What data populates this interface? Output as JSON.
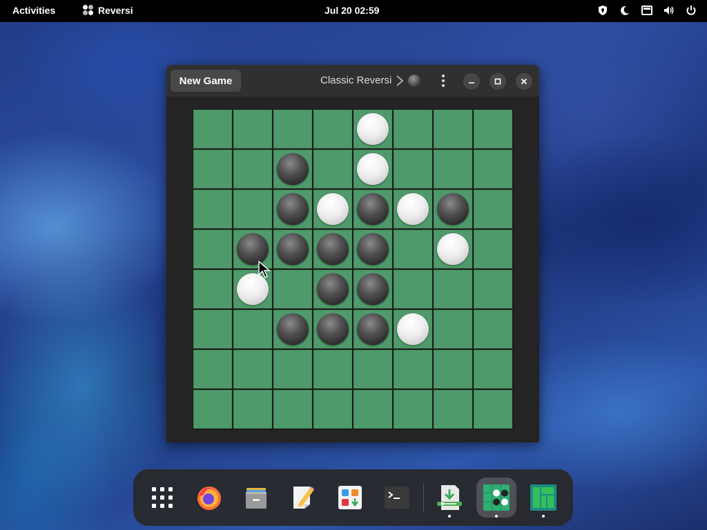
{
  "topbar": {
    "activities": "Activities",
    "app_name": "Reversi",
    "clock": "Jul 20  02:59",
    "tray_icons": [
      "shield-icon",
      "night-light-icon",
      "network-icon",
      "volume-icon",
      "power-icon"
    ]
  },
  "window": {
    "new_game_label": "New Game",
    "game_title": "Classic Reversi",
    "turn_indicator": "black",
    "window_buttons": [
      "minimize",
      "maximize",
      "close"
    ]
  },
  "board": {
    "size": 8,
    "rows": [
      [
        "",
        "",
        "",
        "",
        "W",
        "",
        "",
        ""
      ],
      [
        "",
        "",
        "B",
        "",
        "W",
        "",
        "",
        ""
      ],
      [
        "",
        "",
        "B",
        "W",
        "B",
        "W",
        "B",
        ""
      ],
      [
        "",
        "B",
        "B",
        "B",
        "B",
        "",
        "W",
        ""
      ],
      [
        "",
        "W",
        "",
        "B",
        "B",
        "",
        "",
        ""
      ],
      [
        "",
        "",
        "B",
        "B",
        "B",
        "W",
        "",
        ""
      ],
      [
        "",
        "",
        "",
        "",
        "",
        "",
        "",
        ""
      ],
      [
        "",
        "",
        "",
        "",
        "",
        "",
        "",
        ""
      ]
    ]
  },
  "dock": {
    "items": [
      {
        "name": "show-apps",
        "icon": "app-grid-icon",
        "running": false
      },
      {
        "name": "firefox",
        "icon": "firefox-icon",
        "running": false
      },
      {
        "name": "files",
        "icon": "files-icon",
        "running": false
      },
      {
        "name": "text-editor",
        "icon": "text-editor-icon",
        "running": false
      },
      {
        "name": "software",
        "icon": "software-icon",
        "running": false
      },
      {
        "name": "terminal",
        "icon": "terminal-icon",
        "running": false
      },
      {
        "name": "software-updater",
        "icon": "updater-icon",
        "running": true
      },
      {
        "name": "reversi",
        "icon": "reversi-icon",
        "running": true
      },
      {
        "name": "manjaro",
        "icon": "manjaro-icon",
        "running": true
      }
    ]
  },
  "colors": {
    "board_green": "#4e9a6a",
    "headerbar": "#303030",
    "window_bg": "#242424",
    "topbar": "#000000"
  }
}
